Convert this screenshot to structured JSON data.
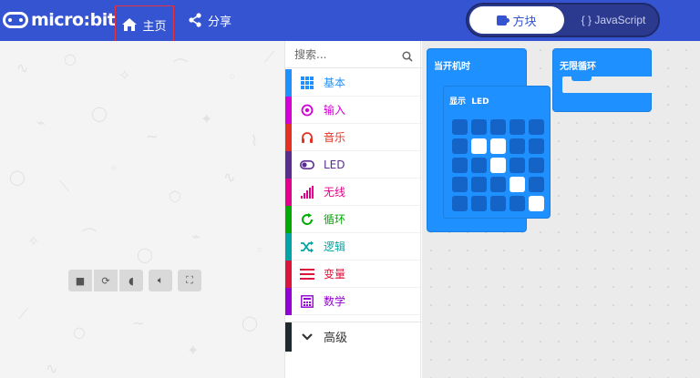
{
  "header": {
    "logo_text": "micro:bit",
    "home_label": "主页",
    "share_label": "分享",
    "toggle_blocks_label": "方块",
    "toggle_js_label": "{ } JavaScript",
    "bg_color": "#3454d1"
  },
  "toolbox": {
    "search_placeholder": "搜索...",
    "categories": [
      {
        "label": "基本",
        "color": "#1e90ff",
        "icon": "grid-icon"
      },
      {
        "label": "输入",
        "color": "#d400d4",
        "icon": "target-icon"
      },
      {
        "label": "音乐",
        "color": "#e63022",
        "icon": "headphones-icon"
      },
      {
        "label": "LED",
        "color": "#5c2d91",
        "icon": "toggle-icon"
      },
      {
        "label": "无线",
        "color": "#e3008c",
        "icon": "signal-icon"
      },
      {
        "label": "循环",
        "color": "#00aa00",
        "icon": "loop-icon"
      },
      {
        "label": "逻辑",
        "color": "#00a4a6",
        "icon": "shuffle-icon"
      },
      {
        "label": "变量",
        "color": "#dc143c",
        "icon": "lines-icon"
      },
      {
        "label": "数学",
        "color": "#9400d3",
        "icon": "calculator-icon"
      }
    ],
    "advanced_label": "高级"
  },
  "workspace": {
    "on_start_label": "当开机时",
    "show_leds_label": "显示",
    "show_leds_sub": "LED",
    "forever_label": "无限循环",
    "leds": [
      [
        0,
        0,
        0,
        0,
        0
      ],
      [
        0,
        1,
        1,
        0,
        0
      ],
      [
        0,
        0,
        1,
        0,
        0
      ],
      [
        0,
        0,
        0,
        1,
        0
      ],
      [
        0,
        0,
        0,
        0,
        1
      ]
    ]
  }
}
